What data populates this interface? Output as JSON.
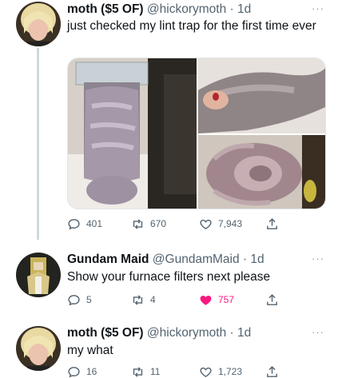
{
  "tweets": [
    {
      "name": "moth ($5 OF)",
      "handle": "@hickorymoth",
      "time": "· 1d",
      "text": "just checked my lint trap for the first time ever",
      "more": "···",
      "stats": {
        "replies": "401",
        "retweets": "670",
        "likes": "7,943"
      },
      "liked": false
    },
    {
      "name": "Gundam Maid",
      "handle": "@GundamMaid",
      "time": "· 1d",
      "text": "Show your furnace filters next please",
      "more": "···",
      "stats": {
        "replies": "5",
        "retweets": "4",
        "likes": "757"
      },
      "liked": true
    },
    {
      "name": "moth ($5 OF)",
      "handle": "@hickorymoth",
      "time": "· 1d",
      "text": "my what",
      "more": "···",
      "stats": {
        "replies": "16",
        "retweets": "11",
        "likes": "1,723"
      },
      "liked": false
    }
  ],
  "icons": {
    "reply": "reply-icon",
    "retweet": "retweet-icon",
    "like": "heart-icon",
    "share": "share-icon",
    "more": "more-icon"
  },
  "colors": {
    "text": "#0f1419",
    "secondary": "#536471",
    "like_active": "#f91880",
    "thread_line": "#cfd9de"
  }
}
